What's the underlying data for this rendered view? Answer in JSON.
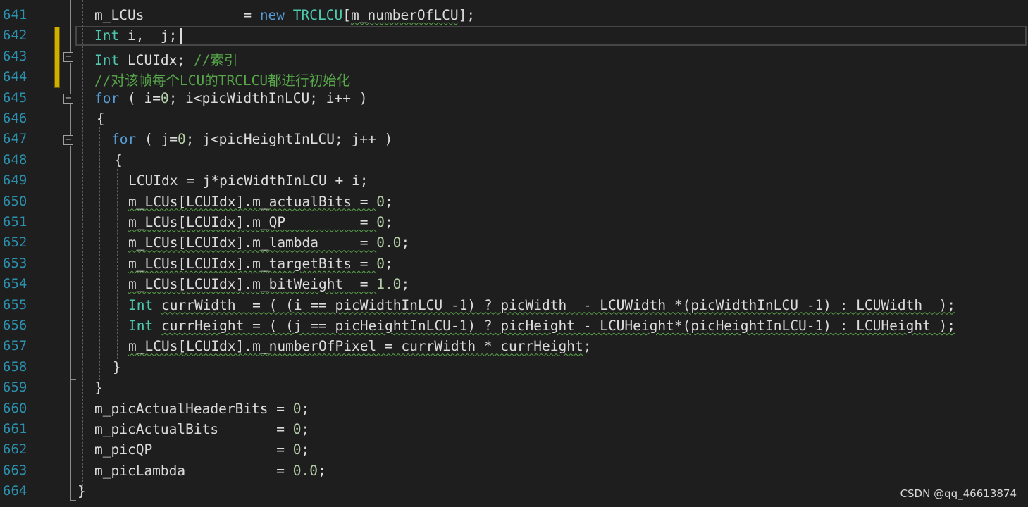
{
  "editor": {
    "lines": [
      {
        "num": "641",
        "tokens": [
          {
            "t": "m_LCUs            = ",
            "c": "id"
          },
          {
            "t": "new",
            "c": "kw"
          },
          {
            "t": " ",
            "c": "id"
          },
          {
            "t": "TRCLCU",
            "c": "ty"
          },
          {
            "t": "[",
            "c": "id"
          },
          {
            "t": "m_numberOfLCU",
            "c": "id",
            "sq": true
          },
          {
            "t": "];",
            "c": "id"
          }
        ]
      },
      {
        "num": "642",
        "tokens": [
          {
            "t": "Int",
            "c": "ty"
          },
          {
            "t": " i,  j;",
            "c": "id"
          }
        ]
      },
      {
        "num": "643",
        "tokens": [
          {
            "t": "Int",
            "c": "ty"
          },
          {
            "t": " LCUIdx; ",
            "c": "id"
          },
          {
            "t": "//索引",
            "c": "cm"
          }
        ]
      },
      {
        "num": "644",
        "tokens": [
          {
            "t": "//对该帧每个LCU的TRCLCU都进行初始化",
            "c": "cm"
          }
        ]
      },
      {
        "num": "645",
        "tokens": [
          {
            "t": "for",
            "c": "kw"
          },
          {
            "t": " ( i=",
            "c": "id"
          },
          {
            "t": "0",
            "c": "num"
          },
          {
            "t": "; i<picWidthInLCU; i++ )",
            "c": "id"
          }
        ]
      },
      {
        "num": "646",
        "tokens": [
          {
            "t": "{",
            "c": "id"
          }
        ]
      },
      {
        "num": "647",
        "tokens": [
          {
            "t": "for",
            "c": "kw"
          },
          {
            "t": " ( j=",
            "c": "id"
          },
          {
            "t": "0",
            "c": "num"
          },
          {
            "t": "; j<picHeightInLCU; j++ )",
            "c": "id"
          }
        ]
      },
      {
        "num": "648",
        "tokens": [
          {
            "t": "{",
            "c": "id"
          }
        ]
      },
      {
        "num": "649",
        "tokens": [
          {
            "t": "LCUIdx = j*picWidthInLCU + i;",
            "c": "id"
          }
        ]
      },
      {
        "num": "650",
        "tokens": [
          {
            "t": "m_LCUs[LCUIdx].m_actualBits = ",
            "c": "id",
            "sq": true
          },
          {
            "t": "0",
            "c": "num"
          },
          {
            "t": ";",
            "c": "id"
          }
        ]
      },
      {
        "num": "651",
        "tokens": [
          {
            "t": "m_LCUs[LCUIdx].m_QP         = ",
            "c": "id",
            "sq": true
          },
          {
            "t": "0",
            "c": "num"
          },
          {
            "t": ";",
            "c": "id"
          }
        ]
      },
      {
        "num": "652",
        "tokens": [
          {
            "t": "m_LCUs[LCUIdx].m_lambda     = ",
            "c": "id",
            "sq": true
          },
          {
            "t": "0.0",
            "c": "num"
          },
          {
            "t": ";",
            "c": "id"
          }
        ]
      },
      {
        "num": "653",
        "tokens": [
          {
            "t": "m_LCUs[LCUIdx].m_targetBits = ",
            "c": "id",
            "sq": true
          },
          {
            "t": "0",
            "c": "num"
          },
          {
            "t": ";",
            "c": "id"
          }
        ]
      },
      {
        "num": "654",
        "tokens": [
          {
            "t": "m_LCUs[LCUIdx].m_bitWeight  = ",
            "c": "id",
            "sq": true
          },
          {
            "t": "1.0",
            "c": "num"
          },
          {
            "t": ";",
            "c": "id"
          }
        ]
      },
      {
        "num": "655",
        "tokens": [
          {
            "t": "Int",
            "c": "ty"
          },
          {
            "t": " ",
            "c": "id"
          },
          {
            "t": "currWidth  = ( (i == picWidthInLCU -1) ? picWidth  - LCUWidth *(picWidthInLCU -1) : LCUWidth  );",
            "c": "id",
            "sq": true
          }
        ]
      },
      {
        "num": "656",
        "tokens": [
          {
            "t": "Int",
            "c": "ty"
          },
          {
            "t": " ",
            "c": "id"
          },
          {
            "t": "currHeight = ( (j == picHeightInLCU-1) ? picHeight - LCUHeight*(picHeightInLCU-1) : LCUHeight );",
            "c": "id",
            "sq": true
          }
        ]
      },
      {
        "num": "657",
        "tokens": [
          {
            "t": "m_LCUs[LCUIdx].m_numberOfPixel = currWidth * currHeight",
            "c": "id",
            "sq": true
          },
          {
            "t": ";",
            "c": "id"
          }
        ]
      },
      {
        "num": "658",
        "tokens": [
          {
            "t": "}",
            "c": "id"
          }
        ]
      },
      {
        "num": "659",
        "tokens": [
          {
            "t": "}",
            "c": "id"
          }
        ]
      },
      {
        "num": "660",
        "tokens": [
          {
            "t": "m_picActualHeaderBits = ",
            "c": "id"
          },
          {
            "t": "0",
            "c": "num"
          },
          {
            "t": ";",
            "c": "id"
          }
        ]
      },
      {
        "num": "661",
        "tokens": [
          {
            "t": "m_picActualBits       = ",
            "c": "id"
          },
          {
            "t": "0",
            "c": "num"
          },
          {
            "t": ";",
            "c": "id"
          }
        ]
      },
      {
        "num": "662",
        "tokens": [
          {
            "t": "m_picQP               = ",
            "c": "id"
          },
          {
            "t": "0",
            "c": "num"
          },
          {
            "t": ";",
            "c": "id"
          }
        ]
      },
      {
        "num": "663",
        "tokens": [
          {
            "t": "m_picLambda           = ",
            "c": "id"
          },
          {
            "t": "0.0",
            "c": "num"
          },
          {
            "t": ";",
            "c": "id"
          }
        ]
      },
      {
        "num": "664",
        "tokens": [
          {
            "t": "}",
            "c": "id"
          }
        ]
      }
    ]
  },
  "watermark": "CSDN @qq_46613874",
  "colors": {
    "background": "#1e1e1e",
    "line_number": "#2b91af",
    "keyword": "#569cd6",
    "type": "#4ec9b0",
    "comment": "#57a64a",
    "number": "#b5cea8",
    "text": "#dcdcdc",
    "modified_marker": "#cfb000"
  }
}
